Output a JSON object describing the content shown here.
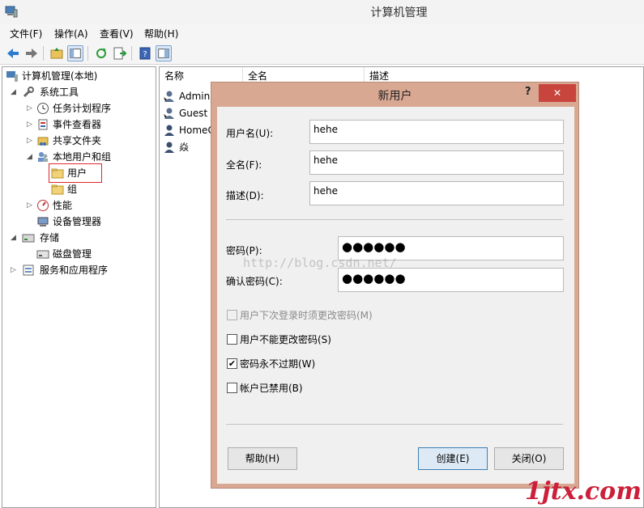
{
  "window": {
    "title": "计算机管理"
  },
  "menu": [
    {
      "label": "文件(F)"
    },
    {
      "label": "操作(A)"
    },
    {
      "label": "查看(V)"
    },
    {
      "label": "帮助(H)"
    }
  ],
  "tree": {
    "root": "计算机管理(本地)",
    "system_tools": "系统工具",
    "task_scheduler": "任务计划程序",
    "event_viewer": "事件查看器",
    "shared_folders": "共享文件夹",
    "local_users_groups": "本地用户和组",
    "users": "用户",
    "groups": "组",
    "performance": "性能",
    "device_manager": "设备管理器",
    "storage": "存储",
    "disk_management": "磁盘管理",
    "services_apps": "服务和应用程序"
  },
  "list": {
    "columns": [
      "名称",
      "全名",
      "描述"
    ],
    "rows": [
      "Admini",
      "Guest",
      "HomeG",
      "焱"
    ]
  },
  "dialog": {
    "title": "新用户",
    "help_glyph": "?",
    "close_glyph": "✕",
    "username_label": "用户名(U):",
    "username_value": "hehe",
    "fullname_label": "全名(F):",
    "fullname_value": "hehe",
    "description_label": "描述(D):",
    "description_value": "hehe",
    "password_label": "密码(P):",
    "password_value": "●●●●●●",
    "confirm_label": "确认密码(C):",
    "confirm_value": "●●●●●●",
    "must_change_label": "用户下次登录时须更改密码(M)",
    "cannot_change_label": "用户不能更改密码(S)",
    "never_expires_label": "密码永不过期(W)",
    "disabled_label": "帐户已禁用(B)",
    "check_mark": "✔",
    "help_button": "帮助(H)",
    "create_button": "创建(E)",
    "close_button": "关闭(O)"
  },
  "watermark": "http://blog.csdn.net/",
  "brand": "1jtx.com",
  "colors": {
    "dialog_frame": "#d9a893",
    "close_button": "#c7453d",
    "selection_outline": "#e0262a",
    "brand": "#cc1f3a"
  }
}
